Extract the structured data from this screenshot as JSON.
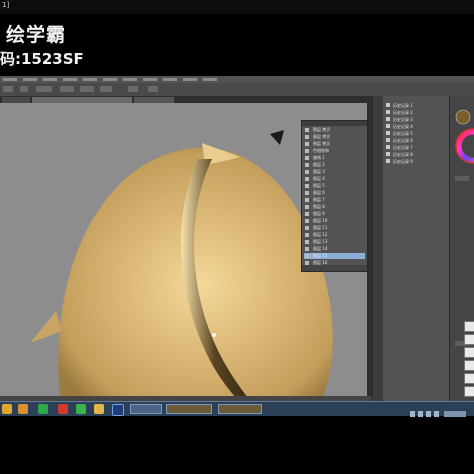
{
  "overlay": {
    "title": "绘学霸",
    "code": "码:1523SF",
    "topstrip_text": "1]"
  },
  "photoshop": {
    "menu_items": [
      "menu",
      "menu",
      "menu",
      "menu",
      "menu",
      "menu",
      "menu",
      "menu",
      "menu",
      "menu",
      "menu"
    ],
    "layers_panel": {
      "rows": [
        {
          "label": "图层 拷贝",
          "selected": false
        },
        {
          "label": "图层 拷贝",
          "selected": false
        },
        {
          "label": "图层 拷贝",
          "selected": false
        },
        {
          "label": "色相饱和",
          "selected": false
        },
        {
          "label": "曲线 1",
          "selected": false
        },
        {
          "label": "图层 2",
          "selected": false
        },
        {
          "label": "图层 3",
          "selected": false
        },
        {
          "label": "图层 4",
          "selected": false
        },
        {
          "label": "图层 5",
          "selected": false
        },
        {
          "label": "图层 6",
          "selected": false
        },
        {
          "label": "图层 7",
          "selected": false
        },
        {
          "label": "图层 8",
          "selected": false
        },
        {
          "label": "图层 9",
          "selected": false
        },
        {
          "label": "图层 10",
          "selected": false
        },
        {
          "label": "图层 11",
          "selected": false
        },
        {
          "label": "图层 12",
          "selected": false
        },
        {
          "label": "图层 13",
          "selected": false
        },
        {
          "label": "图层 14",
          "selected": false
        },
        {
          "label": "图层 15",
          "selected": true
        },
        {
          "label": "图层 16",
          "selected": false
        }
      ]
    },
    "history_panel": {
      "rows": [
        "历史记录 1",
        "历史记录 2",
        "历史记录 3",
        "历史记录 4",
        "历史记录 5",
        "历史记录 6",
        "历史记录 7",
        "历史记录 8",
        "历史记录 9"
      ]
    },
    "colors": {
      "canvas_bg": "#8d8d8d",
      "object_main": "#d2ad6a",
      "object_dark": "#4a3a1c",
      "foreground_swatch": "#7a5f2a"
    }
  },
  "taskbar": {
    "windows": [
      "",
      "",
      ""
    ]
  }
}
